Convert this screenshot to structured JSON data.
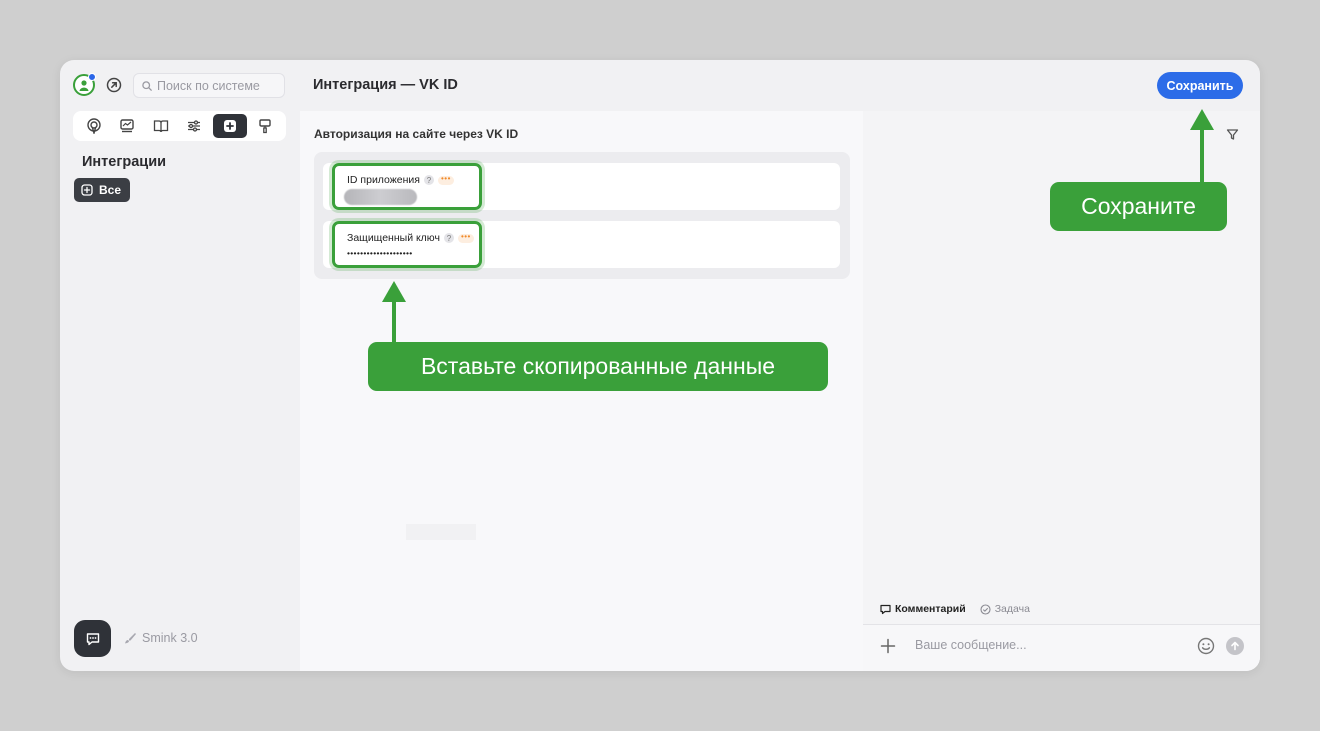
{
  "header": {
    "search_placeholder": "Поиск по системе",
    "page_title": "Интеграция — VK ID",
    "save_label": "Сохранить"
  },
  "sidebar": {
    "tools": [
      "podcast-icon",
      "dashboard-icon",
      "book-icon",
      "sliders-icon",
      "plus-square-icon",
      "roller-icon"
    ],
    "active_tool": 4,
    "title": "Интеграции",
    "filter_label": "Все",
    "version_label": "Smink 3.0"
  },
  "main": {
    "section_title": "Авторизация на сайте через VK ID",
    "fields": [
      {
        "label": "ID приложения",
        "help": "?",
        "value_hidden": true
      },
      {
        "label": "Защищенный ключ",
        "help": "?",
        "value": "••••••••••••••••••••"
      }
    ]
  },
  "right_panel": {
    "tabs": [
      {
        "label": "Комментарий",
        "active": true
      },
      {
        "label": "Задача",
        "active": false
      }
    ],
    "message_placeholder": "Ваше сообщение..."
  },
  "annotations": {
    "save_hint": "Сохраните",
    "paste_hint": "Вставьте скопированные данные"
  },
  "colors": {
    "accent_blue": "#2c6ce8",
    "annotation_green": "#3aa03a",
    "dark_button": "#2f3238"
  }
}
